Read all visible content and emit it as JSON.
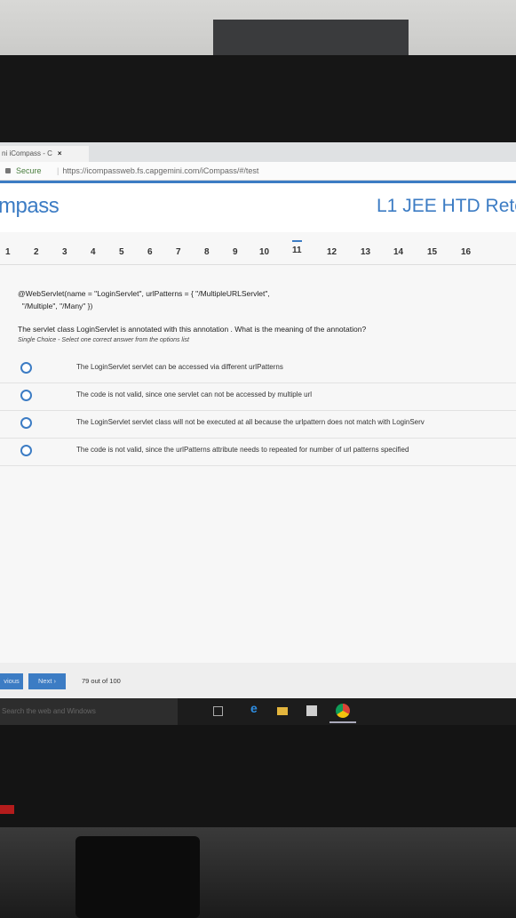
{
  "browser": {
    "tab_title": "ni iCompass - C",
    "tab_close": "×",
    "secure_label": "Secure",
    "url": "https://icompassweb.fs.capgemini.com/iCompass/#/test"
  },
  "header": {
    "logo": "mpass",
    "test_title": "L1 JEE HTD Rete"
  },
  "question_nav": {
    "numbers": [
      "1",
      "2",
      "3",
      "4",
      "5",
      "6",
      "7",
      "8",
      "9",
      "10",
      "11",
      "12",
      "13",
      "14",
      "15",
      "16"
    ],
    "active": "11"
  },
  "question": {
    "code_line1": "@WebServlet(name = \"LoginServlet\", urlPatterns = { \"/MultipleURLServlet\",",
    "code_line2": "\"/Multiple\", \"/Many\" })",
    "text": "The servlet class LoginServlet is annotated with this annotation . What is the meaning of the annotation?",
    "hint": "Single Choice - Select one correct answer from the options list",
    "options": [
      "The LoginServlet servlet can be accessed via different urlPatterns",
      "The code is not valid, since one servlet can not be accessed by multiple url",
      "The LoginServlet servlet class will not be executed at all because the urlpattern does not match with LoginServ",
      "The code is not valid, since the urlPatterns attribute needs to repeated for number of url patterns specified"
    ]
  },
  "footer": {
    "previous_label": "vious",
    "next_label": "Next ›",
    "progress": "79 out of 100"
  },
  "taskbar": {
    "search_placeholder": "Search the web and Windows"
  },
  "colors": {
    "accent": "#3c7cc4",
    "taskbar": "#1c1c1c"
  }
}
